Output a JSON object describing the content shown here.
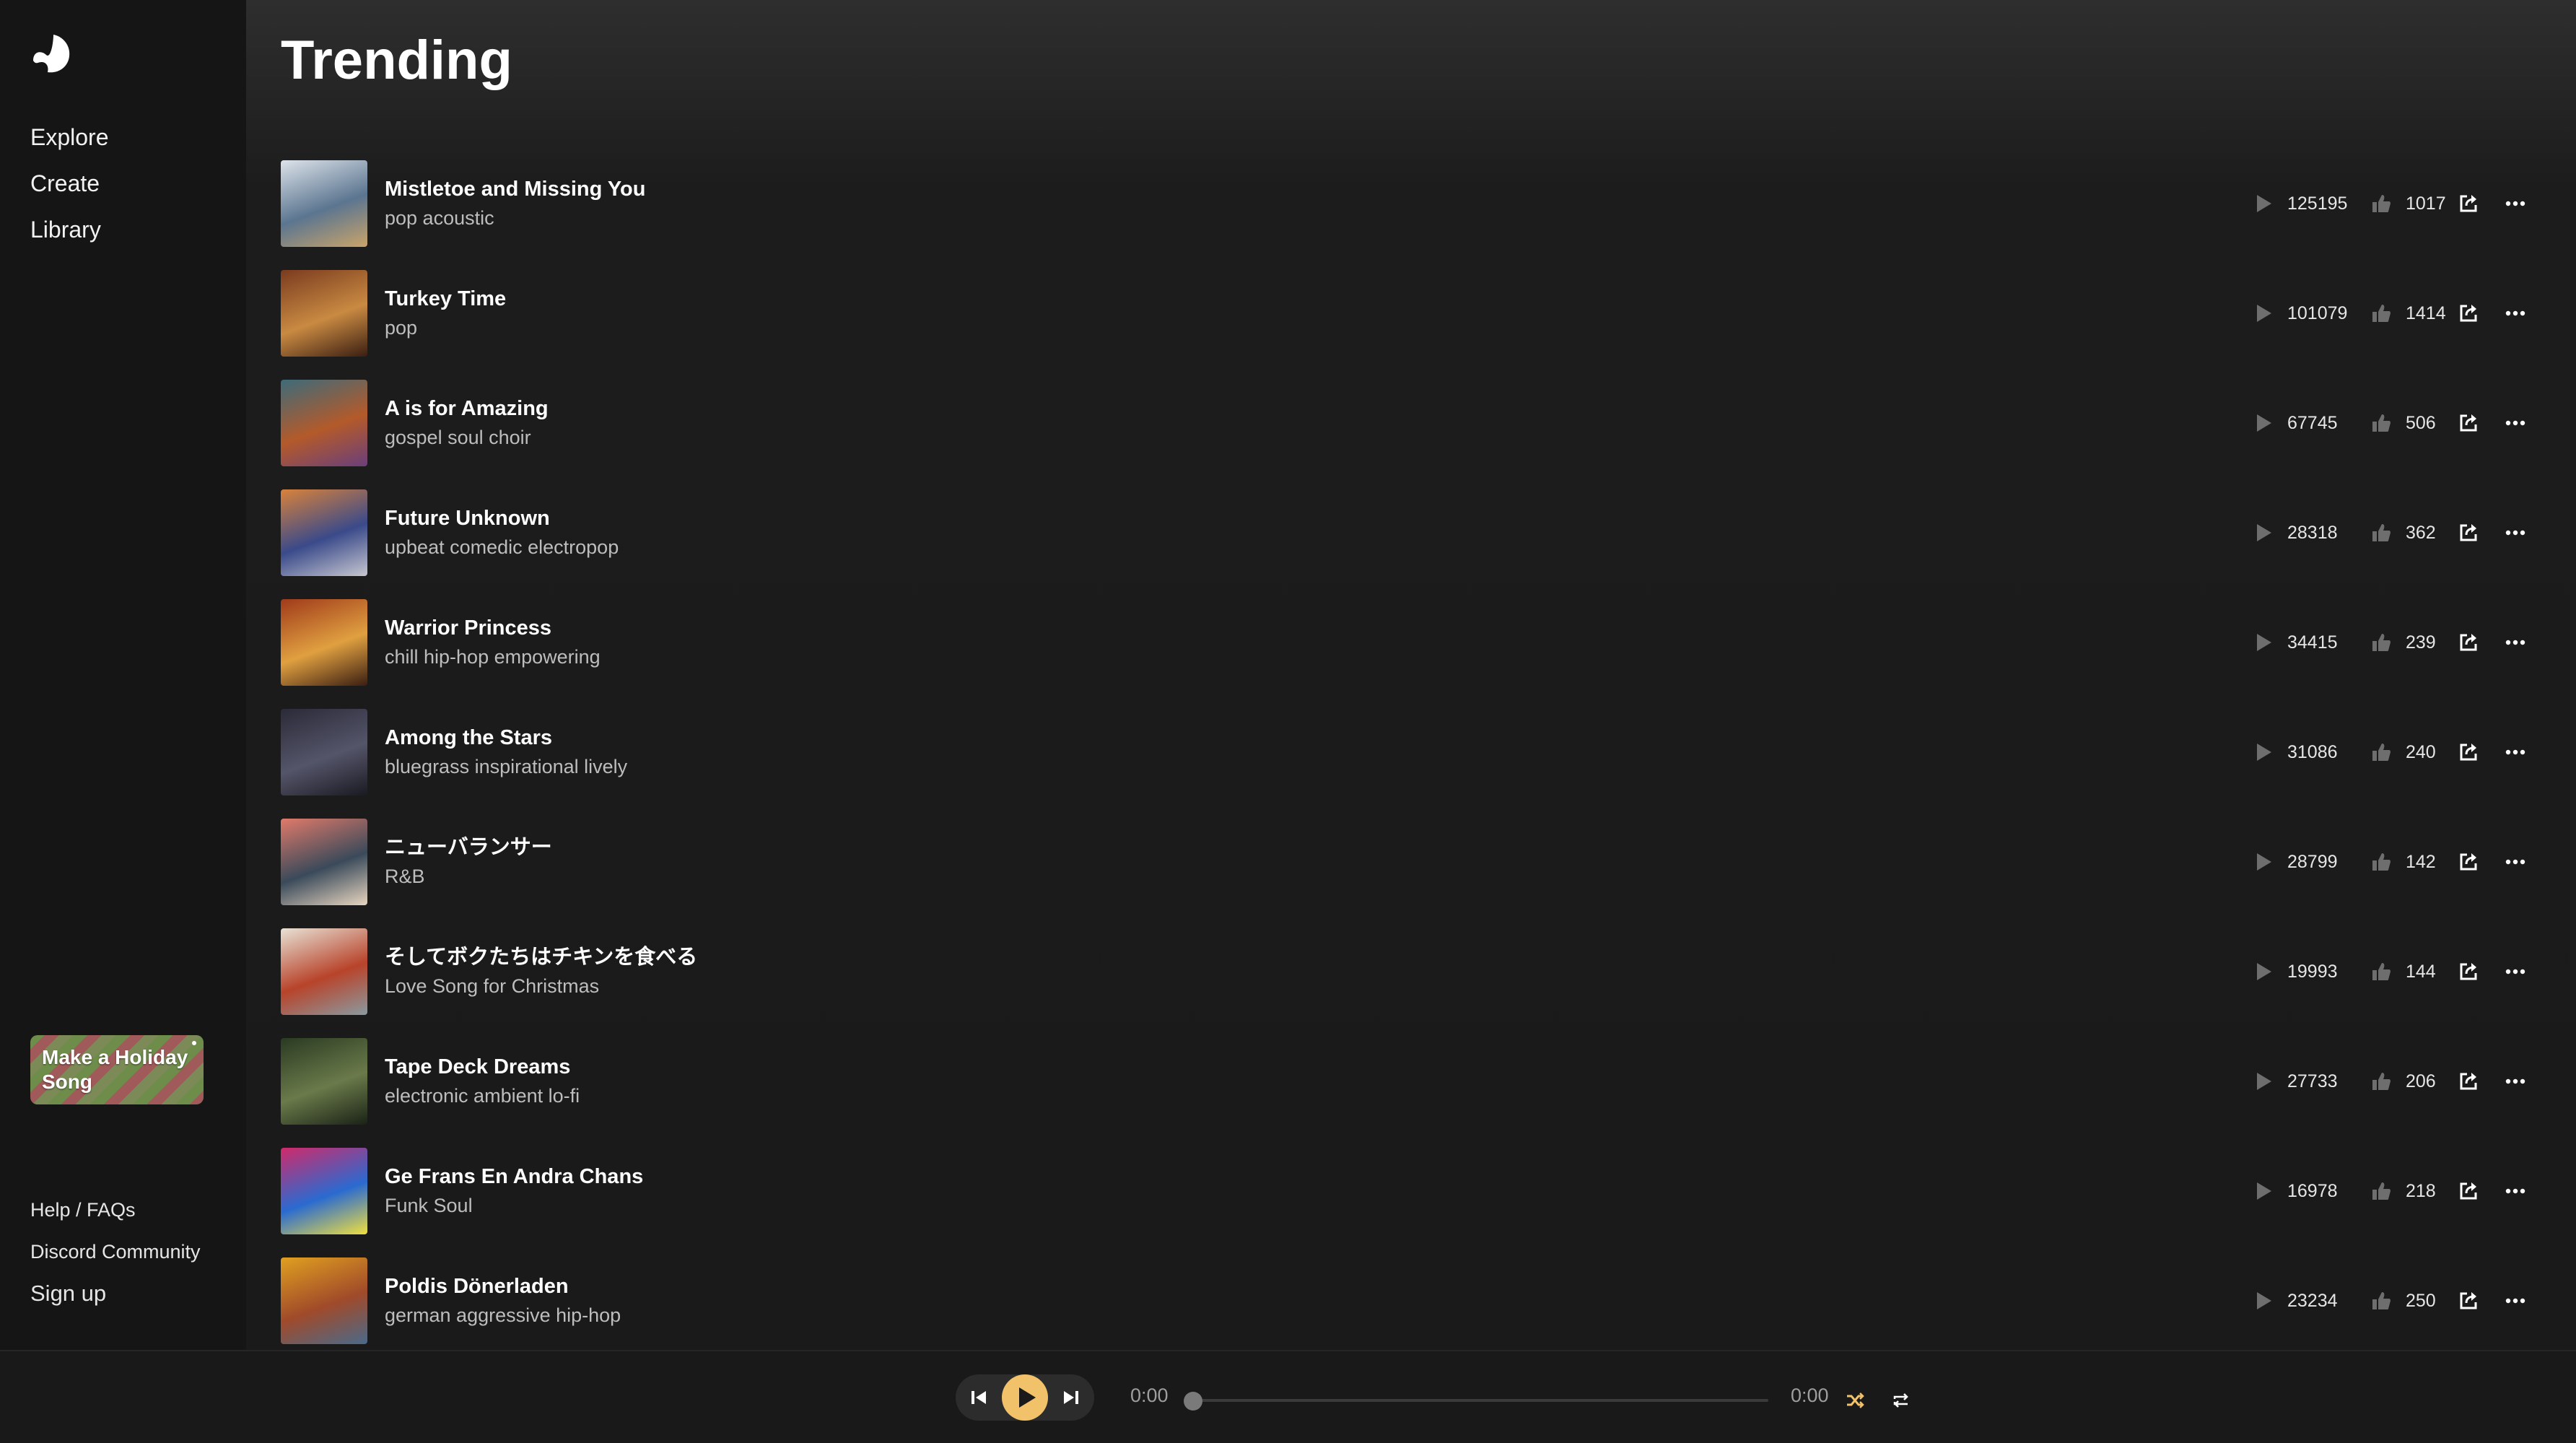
{
  "sidebar": {
    "logo_icon": "suno-wave-logo",
    "nav": [
      {
        "label": "Explore"
      },
      {
        "label": "Create"
      },
      {
        "label": "Library"
      }
    ],
    "promo": {
      "label": "Make a Holiday Song"
    },
    "footer": {
      "help": "Help / FAQs",
      "discord": "Discord Community",
      "signup": "Sign up"
    }
  },
  "main": {
    "title": "Trending",
    "tracks": [
      {
        "title": "Mistletoe and Missing You",
        "genre": "pop acoustic",
        "plays": "125195",
        "likes": "1017",
        "cover_colors": [
          "#dde3ea",
          "#5b7590",
          "#c9a46a"
        ]
      },
      {
        "title": "Turkey Time",
        "genre": "pop",
        "plays": "101079",
        "likes": "1414",
        "cover_colors": [
          "#7a3b1f",
          "#c98a42",
          "#3a1e12"
        ]
      },
      {
        "title": "A is for Amazing",
        "genre": "gospel soul choir",
        "plays": "67745",
        "likes": "506",
        "cover_colors": [
          "#3d6b7a",
          "#b45a2a",
          "#6a3f7a"
        ]
      },
      {
        "title": "Future Unknown",
        "genre": "upbeat comedic electropop",
        "plays": "28318",
        "likes": "362",
        "cover_colors": [
          "#d9823a",
          "#3a4a8a",
          "#c7c7d0"
        ]
      },
      {
        "title": "Warrior Princess",
        "genre": "chill hip-hop empowering",
        "plays": "34415",
        "likes": "239",
        "cover_colors": [
          "#a03a1a",
          "#e0a040",
          "#3a1e12"
        ]
      },
      {
        "title": "Among the Stars",
        "genre": "bluegrass inspirational lively",
        "plays": "31086",
        "likes": "240",
        "cover_colors": [
          "#2a2a38",
          "#55556a",
          "#1a1a22"
        ]
      },
      {
        "title": "ニューバランサー",
        "genre": "R&B",
        "plays": "28799",
        "likes": "142",
        "cover_colors": [
          "#e07a6a",
          "#3a4a5a",
          "#e8d6c0"
        ]
      },
      {
        "title": "そしてボクたちはチキンを食べる",
        "genre": "Love Song for Christmas",
        "plays": "19993",
        "likes": "144",
        "cover_colors": [
          "#e8e2d6",
          "#b8432a",
          "#8a9aa0"
        ]
      },
      {
        "title": "Tape Deck Dreams",
        "genre": "electronic ambient lo-fi",
        "plays": "27733",
        "likes": "206",
        "cover_colors": [
          "#2a3a22",
          "#6a7a4a",
          "#1a2216"
        ]
      },
      {
        "title": "Ge Frans En Andra Chans",
        "genre": "Funk Soul",
        "plays": "16978",
        "likes": "218",
        "cover_colors": [
          "#d02a6a",
          "#2a6ad0",
          "#f0e040"
        ]
      },
      {
        "title": "Poldis Dönerladen",
        "genre": "german aggressive hip-hop",
        "plays": "23234",
        "likes": "250",
        "cover_colors": [
          "#e0a020",
          "#a04a2a",
          "#4a6a8a"
        ]
      }
    ]
  },
  "player": {
    "current_time": "0:00",
    "duration": "0:00",
    "progress": 0,
    "accent": "#f2c26b"
  }
}
